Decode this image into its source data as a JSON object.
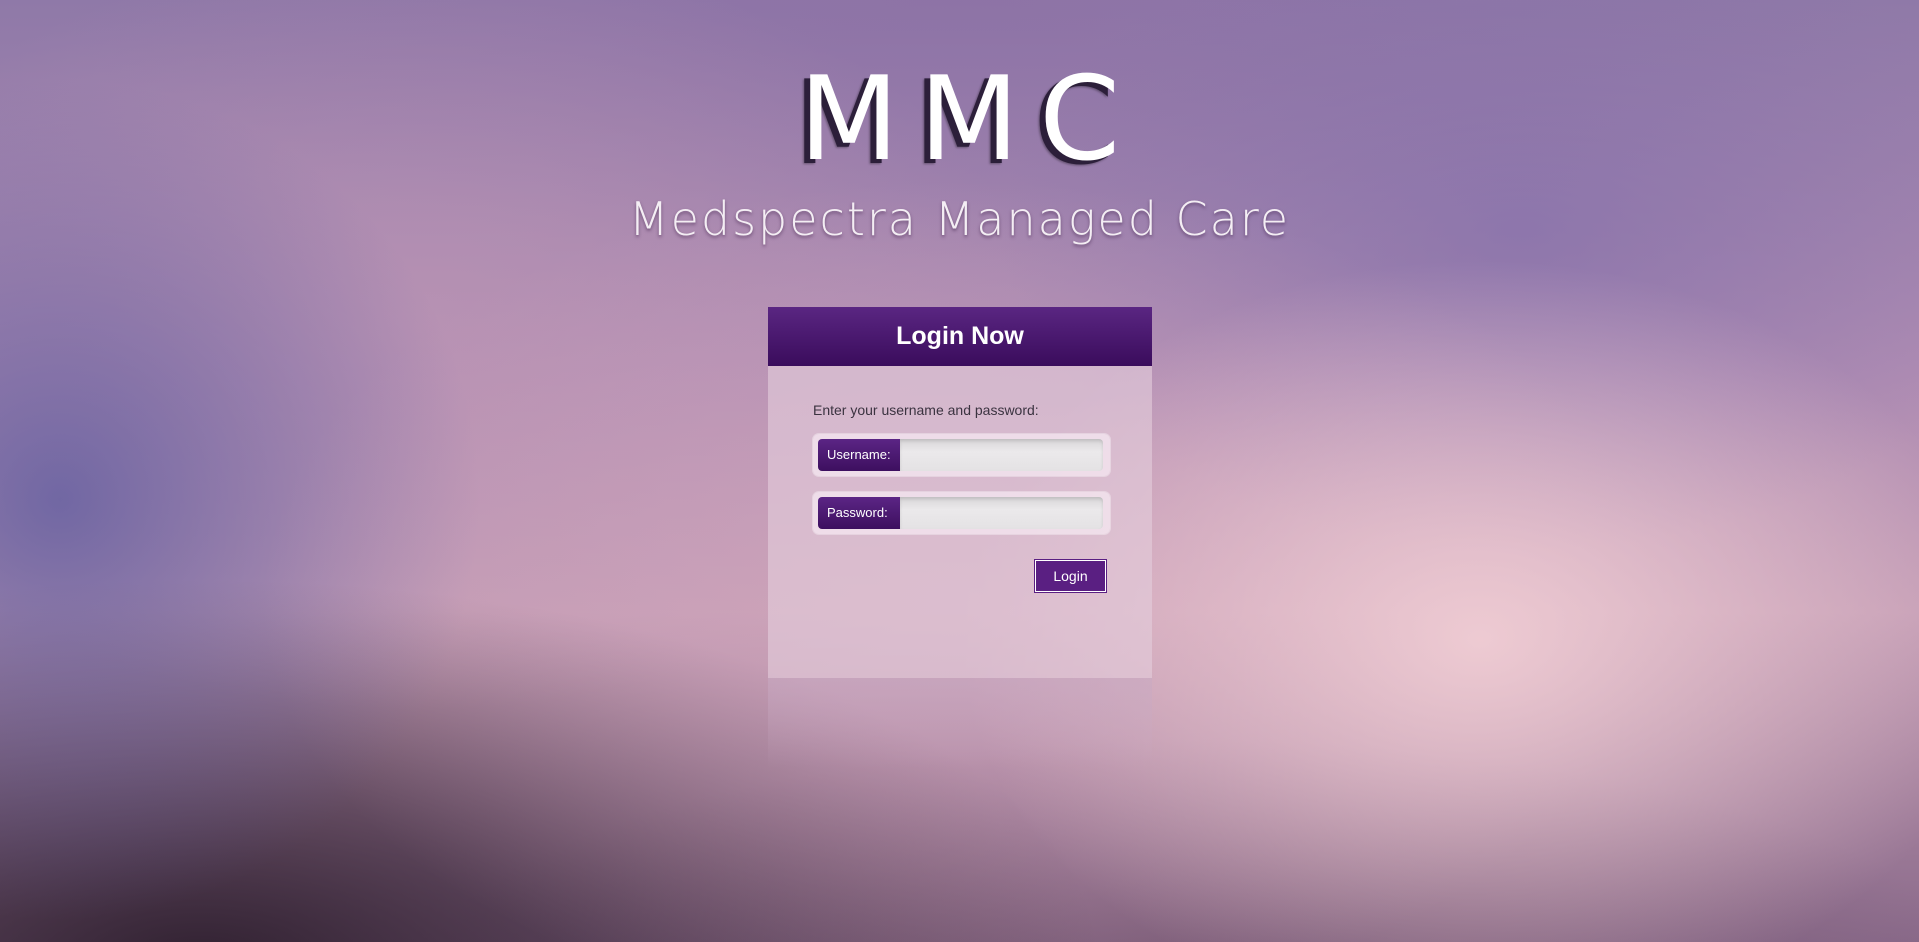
{
  "branding": {
    "logo": "MMC",
    "tagline": "Medspectra Managed Care"
  },
  "login": {
    "title": "Login Now",
    "instructions": "Enter your username and password:",
    "username_label": "Username:",
    "username_value": "",
    "password_label": "Password:",
    "password_value": "",
    "submit_label": "Login"
  },
  "colors": {
    "header_top": "#5a2682",
    "header_bottom": "#3a0c5c",
    "button": "#5a1f82",
    "label_bg": "#4a1870"
  }
}
